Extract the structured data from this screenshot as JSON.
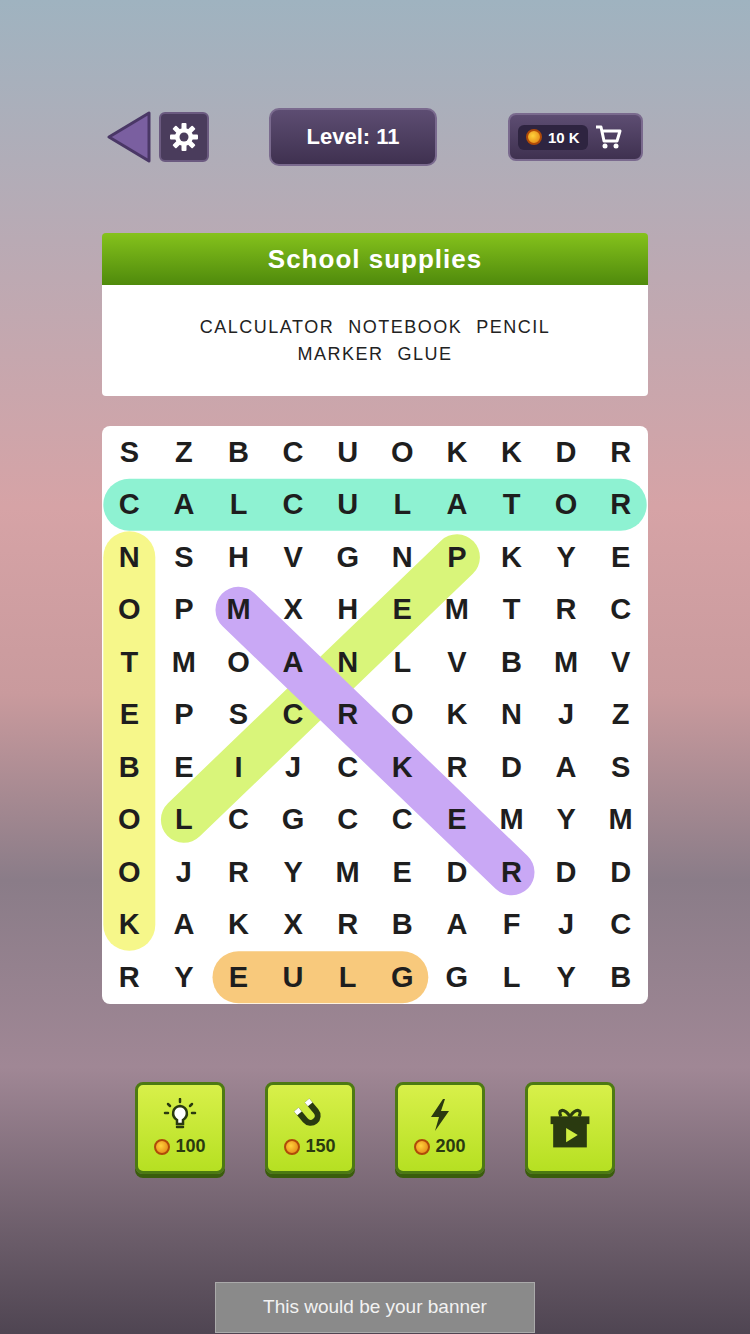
{
  "level": "Level: 11",
  "coins": "10 K",
  "category": "School supplies",
  "word_rows": [
    [
      "CALCULATOR",
      "NOTEBOOK",
      "PENCIL"
    ],
    [
      "MARKER",
      "GLUE"
    ]
  ],
  "grid": [
    [
      "S",
      "Z",
      "B",
      "C",
      "U",
      "O",
      "K",
      "K",
      "D",
      "R"
    ],
    [
      "C",
      "A",
      "L",
      "C",
      "U",
      "L",
      "A",
      "T",
      "O",
      "R"
    ],
    [
      "N",
      "S",
      "H",
      "V",
      "G",
      "N",
      "P",
      "K",
      "Y",
      "E"
    ],
    [
      "O",
      "P",
      "M",
      "X",
      "H",
      "E",
      "M",
      "T",
      "R",
      "C"
    ],
    [
      "T",
      "M",
      "O",
      "A",
      "N",
      "L",
      "V",
      "B",
      "M",
      "V"
    ],
    [
      "E",
      "P",
      "S",
      "C",
      "R",
      "O",
      "K",
      "N",
      "J",
      "Z"
    ],
    [
      "B",
      "E",
      "I",
      "J",
      "C",
      "K",
      "R",
      "D",
      "A",
      "S"
    ],
    [
      "O",
      "L",
      "C",
      "G",
      "C",
      "C",
      "E",
      "M",
      "Y",
      "M"
    ],
    [
      "O",
      "J",
      "R",
      "Y",
      "M",
      "E",
      "D",
      "R",
      "D",
      "D"
    ],
    [
      "K",
      "A",
      "K",
      "X",
      "R",
      "B",
      "A",
      "F",
      "J",
      "C"
    ],
    [
      "R",
      "Y",
      "E",
      "U",
      "L",
      "G",
      "G",
      "L",
      "Y",
      "B"
    ]
  ],
  "found": [
    {
      "color": "#8ef2d2",
      "start": [
        1,
        0
      ],
      "end": [
        1,
        9
      ]
    },
    {
      "color": "#f6f78a",
      "start": [
        2,
        0
      ],
      "end": [
        9,
        0
      ]
    },
    {
      "color": "#d9f57a",
      "start": [
        2,
        6
      ],
      "end": [
        7,
        1
      ]
    },
    {
      "color": "#c9a8f5",
      "start": [
        3,
        2
      ],
      "end": [
        8,
        7
      ]
    },
    {
      "color": "#f8c97c",
      "start": [
        10,
        5
      ],
      "end": [
        10,
        2
      ]
    }
  ],
  "powerups": [
    {
      "kind": "hint",
      "price": "100"
    },
    {
      "kind": "magnet",
      "price": "150"
    },
    {
      "kind": "bolt",
      "price": "200"
    },
    {
      "kind": "video"
    }
  ],
  "banner": "This would be your banner"
}
